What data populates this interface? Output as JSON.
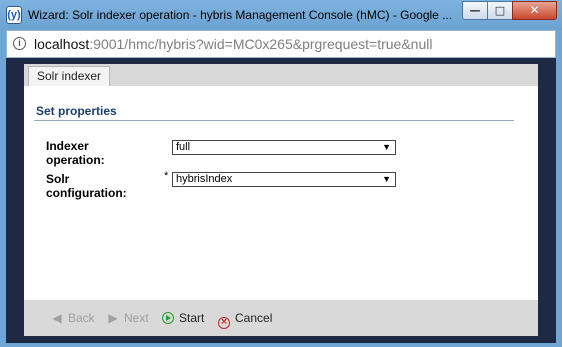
{
  "window": {
    "title": "Wizard: Solr indexer operation - hybris Management Console (hMC) - Google ...",
    "app_icon_letter": "(y)",
    "minimize_glyph": "—",
    "maximize_glyph": "□",
    "close_glyph": "✕"
  },
  "address": {
    "host": "localhost",
    "rest": ":9001/hmc/hybris?wid=MC0x265&prgrequest=true&null"
  },
  "tabs": [
    {
      "label": "Solr indexer"
    }
  ],
  "section": {
    "title": "Set properties"
  },
  "fields": {
    "indexer_operation": {
      "label_line1": "Indexer",
      "label_line2": "operation:",
      "value": "full"
    },
    "solr_configuration": {
      "label_line1": "Solr",
      "label_line2": "configuration:",
      "required_mark": "*",
      "value": "hybrisIndex"
    }
  },
  "footer": {
    "back_label": "Back",
    "next_label": "Next",
    "start_label": "Start",
    "cancel_label": "Cancel"
  }
}
